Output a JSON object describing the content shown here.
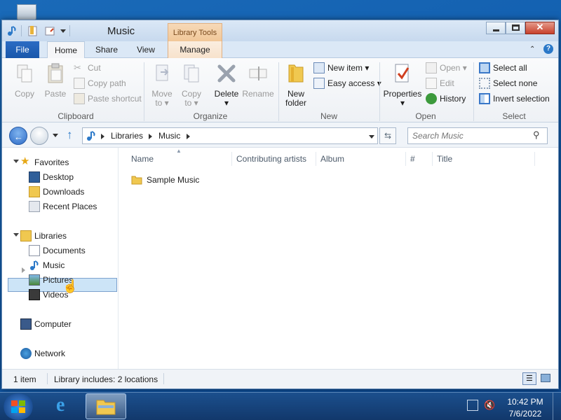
{
  "window": {
    "title": "Music",
    "context_tab": "Library Tools",
    "buttons": {
      "minimize": "minimize",
      "maximize": "maximize",
      "close": "close"
    }
  },
  "tabs": {
    "file": "File",
    "home": "Home",
    "share": "Share",
    "view": "View",
    "manage": "Manage"
  },
  "ribbon": {
    "clipboard": {
      "label": "Clipboard",
      "copy": "Copy",
      "paste": "Paste",
      "cut": "Cut",
      "copy_path": "Copy path",
      "paste_shortcut": "Paste shortcut"
    },
    "organize": {
      "label": "Organize",
      "move_to": "Move to",
      "copy_to": "Copy to",
      "delete": "Delete",
      "rename": "Rename"
    },
    "new": {
      "label": "New",
      "new_folder": "New folder",
      "new_item": "New item",
      "easy_access": "Easy access"
    },
    "open": {
      "label": "Open",
      "properties": "Properties",
      "open": "Open",
      "edit": "Edit",
      "history": "History"
    },
    "select": {
      "label": "Select",
      "select_all": "Select all",
      "select_none": "Select none",
      "invert_selection": "Invert selection"
    }
  },
  "address": {
    "crumbs": [
      "Libraries",
      "Music"
    ],
    "search_placeholder": "Search Music"
  },
  "nav": {
    "favorites": {
      "label": "Favorites",
      "items": [
        "Desktop",
        "Downloads",
        "Recent Places"
      ]
    },
    "libraries": {
      "label": "Libraries",
      "items": [
        "Documents",
        "Music",
        "Pictures",
        "Videos"
      ]
    },
    "computer": "Computer",
    "network": "Network"
  },
  "columns": [
    "Name",
    "Contributing artists",
    "Album",
    "#",
    "Title"
  ],
  "files": [
    {
      "name": "Sample Music"
    }
  ],
  "status": {
    "count": "1 item",
    "library_info": "Library includes: 2 locations"
  },
  "taskbar": {
    "time": "10:42 PM",
    "date": "7/6/2022"
  },
  "colors": {
    "accent": "#1957aa",
    "context_tab": "#f1c798",
    "selection": "#cce4f7"
  }
}
